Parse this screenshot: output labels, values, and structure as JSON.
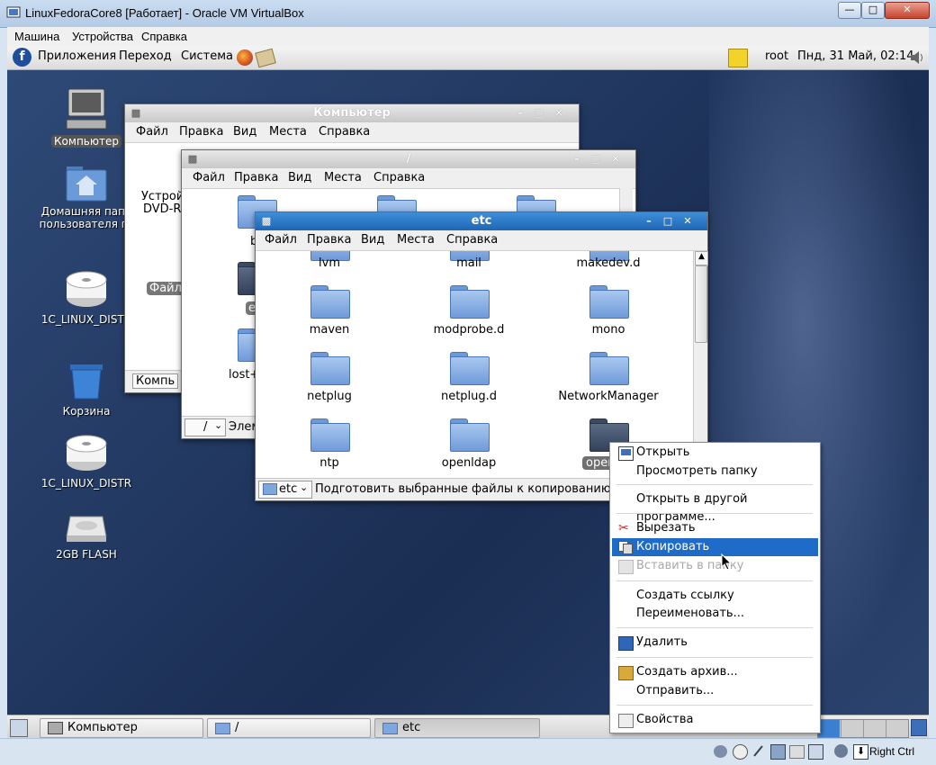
{
  "vbox": {
    "title": "LinuxFedoraCore8 [Работает] - Oracle VM VirtualBox",
    "menu": [
      "Машина",
      "Устройства",
      "Справка"
    ],
    "host_key": "Right Ctrl"
  },
  "gnome_top": {
    "menu": [
      "Приложения",
      "Переход",
      "Система"
    ],
    "user": "root",
    "clock": "Пнд, 31 Май, 02:14"
  },
  "desktop_icons": [
    {
      "label": "Компьютер",
      "icon": "computer-icon"
    },
    {
      "label": "Домашняя папк пользователя го",
      "icon": "home-folder-icon"
    },
    {
      "label": "1C_LINUX_DISTR",
      "icon": "cdrom-icon"
    },
    {
      "label": "Корзина",
      "icon": "trash-icon"
    },
    {
      "label": "1C_LINUX_DISTR",
      "icon": "cdrom-icon"
    },
    {
      "label": "2GB FLASH",
      "icon": "usb-drive-icon"
    }
  ],
  "desktop_icons_lines": {
    "home": [
      "Домашняя папк",
      "пользователя го"
    ]
  },
  "win_computer": {
    "title": "Компьютер",
    "menu": [
      "Файл",
      "Правка",
      "Вид",
      "Места",
      "Справка"
    ],
    "partial_text": [
      "Устрой",
      "DVD-RO",
      "Файлс"
    ],
    "status": "Компь"
  },
  "win_root": {
    "title": "/",
    "menu": [
      "Файл",
      "Правка",
      "Вид",
      "Места",
      "Справка"
    ],
    "partial_labels": [
      "b",
      "e",
      "lost+",
      "Элем"
    ],
    "location": "/"
  },
  "win_etc": {
    "title": "etc",
    "menu": [
      "Файл",
      "Правка",
      "Вид",
      "Места",
      "Справка"
    ],
    "top_row": [
      "lvm",
      "mail",
      "makedev.d"
    ],
    "folders": [
      "maven",
      "modprobe.d",
      "mono",
      "netplug",
      "netplug.d",
      "NetworkManager",
      "ntp",
      "openldap",
      "open"
    ],
    "location": "etc",
    "status": "Подготовить выбранные файлы к копированию с по"
  },
  "context_menu": {
    "items": [
      {
        "label": "Открыть",
        "icon": "open-window-icon",
        "state": "normal"
      },
      {
        "label": "Просмотреть папку",
        "icon": "",
        "state": "normal"
      },
      {
        "label": "Открыть в другой программе...",
        "icon": "",
        "state": "normal"
      },
      {
        "label": "Вырезать",
        "icon": "scissors-icon",
        "state": "normal"
      },
      {
        "label": "Копировать",
        "icon": "copy-icon",
        "state": "highlighted"
      },
      {
        "label": "Вставить в папку",
        "icon": "paste-icon",
        "state": "disabled"
      },
      {
        "label": "Создать ссылку",
        "icon": "",
        "state": "normal"
      },
      {
        "label": "Переименовать...",
        "icon": "",
        "state": "normal"
      },
      {
        "label": "Удалить",
        "icon": "delete-icon",
        "state": "normal"
      },
      {
        "label": "Создать архив...",
        "icon": "archive-icon",
        "state": "normal"
      },
      {
        "label": "Отправить...",
        "icon": "",
        "state": "normal"
      },
      {
        "label": "Свойства",
        "icon": "properties-icon",
        "state": "normal"
      }
    ]
  },
  "taskbar": [
    {
      "label": "Компьютер",
      "icon": "computer-icon"
    },
    {
      "label": "/",
      "icon": "folder-icon"
    },
    {
      "label": "etc",
      "icon": "folder-icon"
    }
  ],
  "colors": {
    "accent": "#1e6cc8",
    "titlebar_active": "#2a78c8",
    "desktop": "#233a63"
  }
}
